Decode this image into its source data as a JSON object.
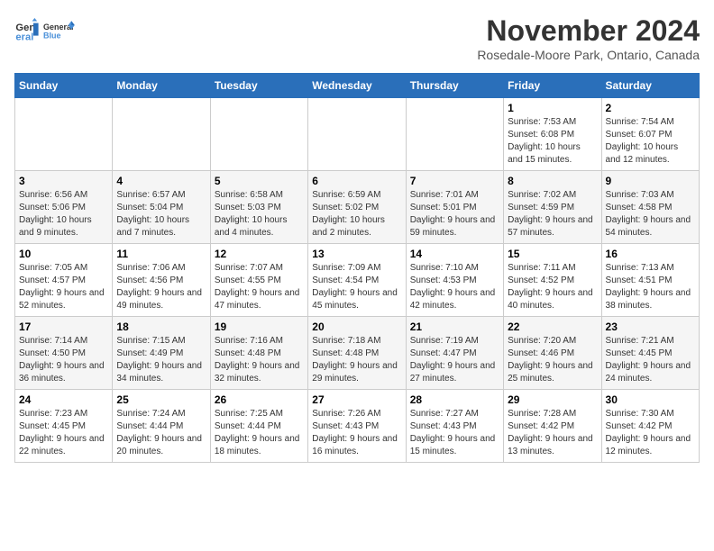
{
  "logo": {
    "line1": "General",
    "line2": "Blue"
  },
  "title": "November 2024",
  "location": "Rosedale-Moore Park, Ontario, Canada",
  "weekdays": [
    "Sunday",
    "Monday",
    "Tuesday",
    "Wednesday",
    "Thursday",
    "Friday",
    "Saturday"
  ],
  "weeks": [
    [
      {
        "day": "",
        "info": ""
      },
      {
        "day": "",
        "info": ""
      },
      {
        "day": "",
        "info": ""
      },
      {
        "day": "",
        "info": ""
      },
      {
        "day": "",
        "info": ""
      },
      {
        "day": "1",
        "info": "Sunrise: 7:53 AM\nSunset: 6:08 PM\nDaylight: 10 hours and 15 minutes."
      },
      {
        "day": "2",
        "info": "Sunrise: 7:54 AM\nSunset: 6:07 PM\nDaylight: 10 hours and 12 minutes."
      }
    ],
    [
      {
        "day": "3",
        "info": "Sunrise: 6:56 AM\nSunset: 5:06 PM\nDaylight: 10 hours and 9 minutes."
      },
      {
        "day": "4",
        "info": "Sunrise: 6:57 AM\nSunset: 5:04 PM\nDaylight: 10 hours and 7 minutes."
      },
      {
        "day": "5",
        "info": "Sunrise: 6:58 AM\nSunset: 5:03 PM\nDaylight: 10 hours and 4 minutes."
      },
      {
        "day": "6",
        "info": "Sunrise: 6:59 AM\nSunset: 5:02 PM\nDaylight: 10 hours and 2 minutes."
      },
      {
        "day": "7",
        "info": "Sunrise: 7:01 AM\nSunset: 5:01 PM\nDaylight: 9 hours and 59 minutes."
      },
      {
        "day": "8",
        "info": "Sunrise: 7:02 AM\nSunset: 4:59 PM\nDaylight: 9 hours and 57 minutes."
      },
      {
        "day": "9",
        "info": "Sunrise: 7:03 AM\nSunset: 4:58 PM\nDaylight: 9 hours and 54 minutes."
      }
    ],
    [
      {
        "day": "10",
        "info": "Sunrise: 7:05 AM\nSunset: 4:57 PM\nDaylight: 9 hours and 52 minutes."
      },
      {
        "day": "11",
        "info": "Sunrise: 7:06 AM\nSunset: 4:56 PM\nDaylight: 9 hours and 49 minutes."
      },
      {
        "day": "12",
        "info": "Sunrise: 7:07 AM\nSunset: 4:55 PM\nDaylight: 9 hours and 47 minutes."
      },
      {
        "day": "13",
        "info": "Sunrise: 7:09 AM\nSunset: 4:54 PM\nDaylight: 9 hours and 45 minutes."
      },
      {
        "day": "14",
        "info": "Sunrise: 7:10 AM\nSunset: 4:53 PM\nDaylight: 9 hours and 42 minutes."
      },
      {
        "day": "15",
        "info": "Sunrise: 7:11 AM\nSunset: 4:52 PM\nDaylight: 9 hours and 40 minutes."
      },
      {
        "day": "16",
        "info": "Sunrise: 7:13 AM\nSunset: 4:51 PM\nDaylight: 9 hours and 38 minutes."
      }
    ],
    [
      {
        "day": "17",
        "info": "Sunrise: 7:14 AM\nSunset: 4:50 PM\nDaylight: 9 hours and 36 minutes."
      },
      {
        "day": "18",
        "info": "Sunrise: 7:15 AM\nSunset: 4:49 PM\nDaylight: 9 hours and 34 minutes."
      },
      {
        "day": "19",
        "info": "Sunrise: 7:16 AM\nSunset: 4:48 PM\nDaylight: 9 hours and 32 minutes."
      },
      {
        "day": "20",
        "info": "Sunrise: 7:18 AM\nSunset: 4:48 PM\nDaylight: 9 hours and 29 minutes."
      },
      {
        "day": "21",
        "info": "Sunrise: 7:19 AM\nSunset: 4:47 PM\nDaylight: 9 hours and 27 minutes."
      },
      {
        "day": "22",
        "info": "Sunrise: 7:20 AM\nSunset: 4:46 PM\nDaylight: 9 hours and 25 minutes."
      },
      {
        "day": "23",
        "info": "Sunrise: 7:21 AM\nSunset: 4:45 PM\nDaylight: 9 hours and 24 minutes."
      }
    ],
    [
      {
        "day": "24",
        "info": "Sunrise: 7:23 AM\nSunset: 4:45 PM\nDaylight: 9 hours and 22 minutes."
      },
      {
        "day": "25",
        "info": "Sunrise: 7:24 AM\nSunset: 4:44 PM\nDaylight: 9 hours and 20 minutes."
      },
      {
        "day": "26",
        "info": "Sunrise: 7:25 AM\nSunset: 4:44 PM\nDaylight: 9 hours and 18 minutes."
      },
      {
        "day": "27",
        "info": "Sunrise: 7:26 AM\nSunset: 4:43 PM\nDaylight: 9 hours and 16 minutes."
      },
      {
        "day": "28",
        "info": "Sunrise: 7:27 AM\nSunset: 4:43 PM\nDaylight: 9 hours and 15 minutes."
      },
      {
        "day": "29",
        "info": "Sunrise: 7:28 AM\nSunset: 4:42 PM\nDaylight: 9 hours and 13 minutes."
      },
      {
        "day": "30",
        "info": "Sunrise: 7:30 AM\nSunset: 4:42 PM\nDaylight: 9 hours and 12 minutes."
      }
    ]
  ]
}
